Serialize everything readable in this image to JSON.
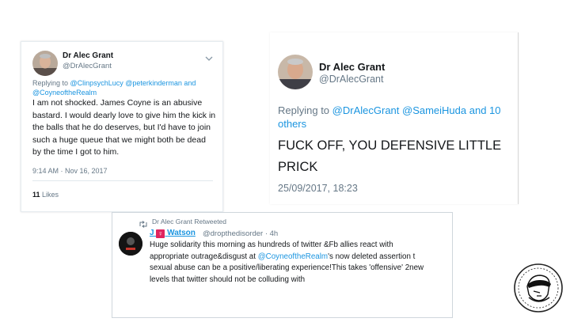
{
  "tweet1": {
    "author": "Dr Alec Grant",
    "handle": "@DrAlecGrant",
    "replying_prefix": "Replying to",
    "reply_handles_line1": "@ClinpsychLucy @peterkinderman and",
    "reply_handles_line2": "@CoyneoftheRealm",
    "body": "I am not shocked. James Coyne is an abusive bastard. I would dearly love to give him the kick  in the balls that he do deserves, but I'd have to join such a huge queue that  we might both be dead by the time I got to him.",
    "timestamp": "9:14 AM · Nov 16, 2017",
    "likes_count": "11",
    "likes_label": "Likes"
  },
  "tweet2": {
    "author": "Dr Alec Grant",
    "handle": "@DrAlecGrant",
    "replying_prefix": "Replying to",
    "reply_handles_line1": "@DrAlecGrant @SameiHuda and 10",
    "reply_handles_line2": "others",
    "body": "FUCK OFF, YOU DEFENSIVE LITTLE PRICK",
    "timestamp": "25/09/2017, 18:23"
  },
  "tweet3": {
    "retweet_label": "Dr Alec Grant Retweeted",
    "author_first": "J",
    "author_last": "Watson",
    "handle_time": "@dropthedisorder · 4h",
    "line1": "Huge solidarity this morning as hundreds of twitter &Fb allies react with",
    "line2_pre": "appropriate outrage&disgust at",
    "line2_mention": "@CoyneoftheRealm",
    "line2_post": "'s now deleted assertion t",
    "line3": "sexual abuse can be a positive/liberating experience!This takes 'offensive' 2new",
    "line4": "levels that twitter should not be colluding with"
  },
  "colors": {
    "link": "#1b95e0",
    "secondary_text": "#657786",
    "venus_badge": "#e0245e"
  },
  "icons": [
    "chevron-down-icon",
    "retweet-icon",
    "venus-icon",
    "logo-stamp"
  ]
}
